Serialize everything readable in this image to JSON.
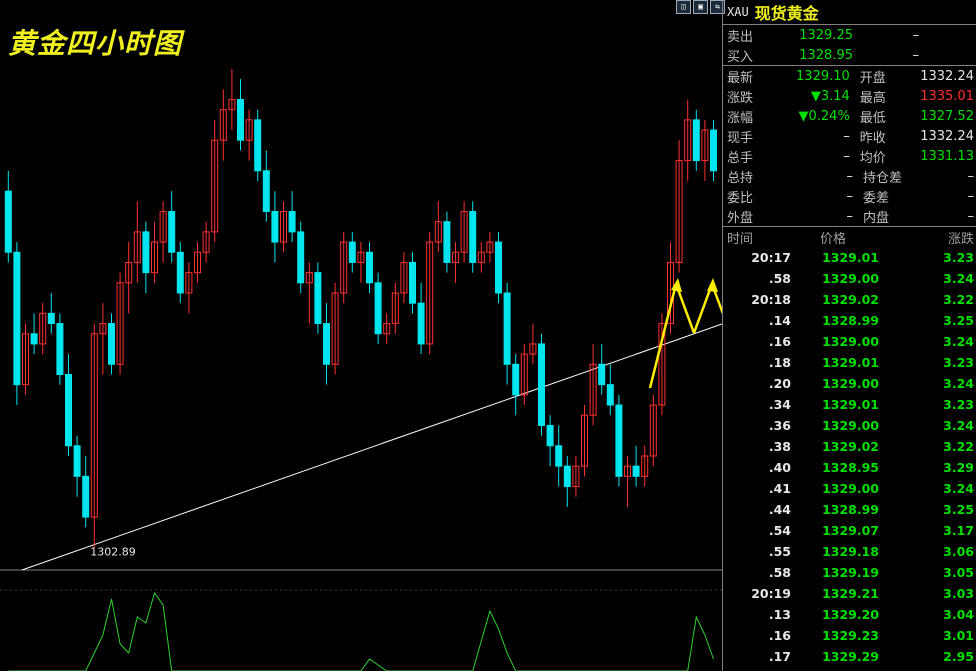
{
  "chart": {
    "title": "黄金四小时图",
    "low_label": "1302.89",
    "view_buttons": [
      "◫",
      "▣",
      "⇆"
    ]
  },
  "panel": {
    "code": "XAU",
    "name": "现货黄金",
    "ask_label": "卖出",
    "ask": "1329.25",
    "ask_vol": "–",
    "bid_label": "买入",
    "bid": "1328.95",
    "bid_vol": "–",
    "stats": [
      {
        "l1": "最新",
        "v1": "1329.10",
        "c1": "green",
        "l2": "开盘",
        "v2": "1332.24",
        "c2": "white"
      },
      {
        "l1": "涨跌",
        "v1": "▼3.14",
        "c1": "green",
        "l2": "最高",
        "v2": "1335.01",
        "c2": "red"
      },
      {
        "l1": "涨幅",
        "v1": "▼0.24%",
        "c1": "green",
        "l2": "最低",
        "v2": "1327.52",
        "c2": "green"
      },
      {
        "l1": "现手",
        "v1": "–",
        "c1": "white",
        "l2": "昨收",
        "v2": "1332.24",
        "c2": "white"
      },
      {
        "l1": "总手",
        "v1": "–",
        "c1": "white",
        "l2": "均价",
        "v2": "1331.13",
        "c2": "green"
      },
      {
        "l1": "总持",
        "v1": "–",
        "c1": "white",
        "l2": "持仓差",
        "v2": "–",
        "c2": "white"
      },
      {
        "l1": "委比",
        "v1": "–",
        "c1": "white",
        "l2": "委差",
        "v2": "–",
        "c2": "white"
      },
      {
        "l1": "外盘",
        "v1": "–",
        "c1": "white",
        "l2": "内盘",
        "v2": "–",
        "c2": "white"
      }
    ],
    "ticks_header": {
      "time": "时间",
      "price": "价格",
      "change": "涨跌"
    },
    "ticks": [
      {
        "t": "20:17",
        "p": "1329.01",
        "c": "3.23"
      },
      {
        "t": ".58",
        "p": "1329.00",
        "c": "3.24"
      },
      {
        "t": "20:18",
        "p": "1329.02",
        "c": "3.22"
      },
      {
        "t": ".14",
        "p": "1328.99",
        "c": "3.25"
      },
      {
        "t": ".16",
        "p": "1329.00",
        "c": "3.24"
      },
      {
        "t": ".18",
        "p": "1329.01",
        "c": "3.23"
      },
      {
        "t": ".20",
        "p": "1329.00",
        "c": "3.24"
      },
      {
        "t": ".34",
        "p": "1329.01",
        "c": "3.23"
      },
      {
        "t": ".36",
        "p": "1329.00",
        "c": "3.24"
      },
      {
        "t": ".38",
        "p": "1329.02",
        "c": "3.22"
      },
      {
        "t": ".40",
        "p": "1328.95",
        "c": "3.29"
      },
      {
        "t": ".41",
        "p": "1329.00",
        "c": "3.24"
      },
      {
        "t": ".44",
        "p": "1328.99",
        "c": "3.25"
      },
      {
        "t": ".54",
        "p": "1329.07",
        "c": "3.17"
      },
      {
        "t": ".55",
        "p": "1329.18",
        "c": "3.06"
      },
      {
        "t": ".58",
        "p": "1329.19",
        "c": "3.05"
      },
      {
        "t": "20:19",
        "p": "1329.21",
        "c": "3.03"
      },
      {
        "t": ".13",
        "p": "1329.20",
        "c": "3.04"
      },
      {
        "t": ".16",
        "p": "1329.23",
        "c": "3.01"
      },
      {
        "t": ".17",
        "p": "1329.29",
        "c": "2.95"
      }
    ]
  },
  "chart_data": {
    "type": "candlestick",
    "y_low_marker": 1302.89,
    "candles": [
      {
        "o": 1325,
        "h": 1327,
        "l": 1318,
        "c": 1319
      },
      {
        "o": 1319,
        "h": 1320,
        "l": 1304,
        "c": 1306
      },
      {
        "o": 1306,
        "h": 1312,
        "l": 1305,
        "c": 1311
      },
      {
        "o": 1311,
        "h": 1313,
        "l": 1309,
        "c": 1310
      },
      {
        "o": 1310,
        "h": 1314,
        "l": 1309,
        "c": 1313
      },
      {
        "o": 1313,
        "h": 1315,
        "l": 1311,
        "c": 1312
      },
      {
        "o": 1312,
        "h": 1313,
        "l": 1306,
        "c": 1307
      },
      {
        "o": 1307,
        "h": 1309,
        "l": 1299,
        "c": 1300
      },
      {
        "o": 1300,
        "h": 1301,
        "l": 1295,
        "c": 1297
      },
      {
        "o": 1297,
        "h": 1299,
        "l": 1292,
        "c": 1293
      },
      {
        "o": 1293,
        "h": 1312,
        "l": 1290,
        "c": 1311
      },
      {
        "o": 1311,
        "h": 1314,
        "l": 1307,
        "c": 1312
      },
      {
        "o": 1312,
        "h": 1313,
        "l": 1307,
        "c": 1308
      },
      {
        "o": 1308,
        "h": 1317,
        "l": 1307,
        "c": 1316
      },
      {
        "o": 1316,
        "h": 1320,
        "l": 1313,
        "c": 1318
      },
      {
        "o": 1318,
        "h": 1324,
        "l": 1316,
        "c": 1321
      },
      {
        "o": 1321,
        "h": 1322,
        "l": 1315,
        "c": 1317
      },
      {
        "o": 1317,
        "h": 1322,
        "l": 1316,
        "c": 1320
      },
      {
        "o": 1320,
        "h": 1324,
        "l": 1318,
        "c": 1323
      },
      {
        "o": 1323,
        "h": 1325,
        "l": 1318,
        "c": 1319
      },
      {
        "o": 1319,
        "h": 1320,
        "l": 1314,
        "c": 1315
      },
      {
        "o": 1315,
        "h": 1318,
        "l": 1313,
        "c": 1317
      },
      {
        "o": 1317,
        "h": 1320,
        "l": 1316,
        "c": 1319
      },
      {
        "o": 1319,
        "h": 1322,
        "l": 1318,
        "c": 1321
      },
      {
        "o": 1321,
        "h": 1332,
        "l": 1320,
        "c": 1330
      },
      {
        "o": 1330,
        "h": 1335,
        "l": 1328,
        "c": 1333
      },
      {
        "o": 1333,
        "h": 1337,
        "l": 1331,
        "c": 1334
      },
      {
        "o": 1334,
        "h": 1336,
        "l": 1329,
        "c": 1330
      },
      {
        "o": 1330,
        "h": 1333,
        "l": 1328,
        "c": 1332
      },
      {
        "o": 1332,
        "h": 1333,
        "l": 1326,
        "c": 1327
      },
      {
        "o": 1327,
        "h": 1329,
        "l": 1322,
        "c": 1323
      },
      {
        "o": 1323,
        "h": 1325,
        "l": 1318,
        "c": 1320
      },
      {
        "o": 1320,
        "h": 1324,
        "l": 1319,
        "c": 1323
      },
      {
        "o": 1323,
        "h": 1325,
        "l": 1320,
        "c": 1321
      },
      {
        "o": 1321,
        "h": 1322,
        "l": 1315,
        "c": 1316
      },
      {
        "o": 1316,
        "h": 1318,
        "l": 1312,
        "c": 1317
      },
      {
        "o": 1317,
        "h": 1318,
        "l": 1311,
        "c": 1312
      },
      {
        "o": 1312,
        "h": 1314,
        "l": 1306,
        "c": 1308
      },
      {
        "o": 1308,
        "h": 1316,
        "l": 1307,
        "c": 1315
      },
      {
        "o": 1315,
        "h": 1321,
        "l": 1314,
        "c": 1320
      },
      {
        "o": 1320,
        "h": 1321,
        "l": 1317,
        "c": 1318
      },
      {
        "o": 1318,
        "h": 1320,
        "l": 1316,
        "c": 1319
      },
      {
        "o": 1319,
        "h": 1320,
        "l": 1315,
        "c": 1316
      },
      {
        "o": 1316,
        "h": 1317,
        "l": 1310,
        "c": 1311
      },
      {
        "o": 1311,
        "h": 1313,
        "l": 1310,
        "c": 1312
      },
      {
        "o": 1312,
        "h": 1316,
        "l": 1311,
        "c": 1315
      },
      {
        "o": 1315,
        "h": 1319,
        "l": 1314,
        "c": 1318
      },
      {
        "o": 1318,
        "h": 1319,
        "l": 1313,
        "c": 1314
      },
      {
        "o": 1314,
        "h": 1316,
        "l": 1309,
        "c": 1310
      },
      {
        "o": 1310,
        "h": 1321,
        "l": 1309,
        "c": 1320
      },
      {
        "o": 1320,
        "h": 1324,
        "l": 1319,
        "c": 1322
      },
      {
        "o": 1322,
        "h": 1323,
        "l": 1317,
        "c": 1318
      },
      {
        "o": 1318,
        "h": 1320,
        "l": 1316,
        "c": 1319
      },
      {
        "o": 1319,
        "h": 1324,
        "l": 1318,
        "c": 1323
      },
      {
        "o": 1323,
        "h": 1324,
        "l": 1317,
        "c": 1318
      },
      {
        "o": 1318,
        "h": 1320,
        "l": 1317,
        "c": 1319
      },
      {
        "o": 1319,
        "h": 1321,
        "l": 1318,
        "c": 1320
      },
      {
        "o": 1320,
        "h": 1321,
        "l": 1314,
        "c": 1315
      },
      {
        "o": 1315,
        "h": 1316,
        "l": 1306,
        "c": 1308
      },
      {
        "o": 1308,
        "h": 1309,
        "l": 1303,
        "c": 1305
      },
      {
        "o": 1305,
        "h": 1310,
        "l": 1304,
        "c": 1309
      },
      {
        "o": 1309,
        "h": 1312,
        "l": 1308,
        "c": 1310
      },
      {
        "o": 1310,
        "h": 1311,
        "l": 1301,
        "c": 1302
      },
      {
        "o": 1302,
        "h": 1303,
        "l": 1298,
        "c": 1300
      },
      {
        "o": 1300,
        "h": 1302,
        "l": 1296,
        "c": 1298
      },
      {
        "o": 1298,
        "h": 1299,
        "l": 1294,
        "c": 1296
      },
      {
        "o": 1296,
        "h": 1299,
        "l": 1295,
        "c": 1298
      },
      {
        "o": 1298,
        "h": 1304,
        "l": 1297,
        "c": 1303
      },
      {
        "o": 1303,
        "h": 1310,
        "l": 1302,
        "c": 1308
      },
      {
        "o": 1308,
        "h": 1310,
        "l": 1305,
        "c": 1306
      },
      {
        "o": 1306,
        "h": 1308,
        "l": 1303,
        "c": 1304
      },
      {
        "o": 1304,
        "h": 1305,
        "l": 1296,
        "c": 1297
      },
      {
        "o": 1297,
        "h": 1299,
        "l": 1294,
        "c": 1298
      },
      {
        "o": 1298,
        "h": 1300,
        "l": 1296,
        "c": 1297
      },
      {
        "o": 1297,
        "h": 1300,
        "l": 1296,
        "c": 1299
      },
      {
        "o": 1299,
        "h": 1305,
        "l": 1298,
        "c": 1304
      },
      {
        "o": 1304,
        "h": 1313,
        "l": 1303,
        "c": 1312
      },
      {
        "o": 1312,
        "h": 1320,
        "l": 1311,
        "c": 1318
      },
      {
        "o": 1318,
        "h": 1330,
        "l": 1317,
        "c": 1328
      },
      {
        "o": 1328,
        "h": 1334,
        "l": 1326,
        "c": 1332
      },
      {
        "o": 1332,
        "h": 1333,
        "l": 1327,
        "c": 1328
      },
      {
        "o": 1328,
        "h": 1332,
        "l": 1326,
        "c": 1331
      },
      {
        "o": 1331,
        "h": 1332,
        "l": 1326,
        "c": 1327
      }
    ],
    "volume": [
      0,
      0,
      0,
      0,
      0,
      0,
      0,
      0,
      0,
      0,
      6,
      12,
      24,
      9,
      6,
      18,
      16,
      26,
      22,
      0,
      0,
      0,
      0,
      0,
      0,
      0,
      0,
      0,
      0,
      0,
      0,
      0,
      0,
      0,
      0,
      0,
      0,
      0,
      0,
      0,
      0,
      0,
      4,
      2,
      0,
      0,
      0,
      0,
      0,
      0,
      0,
      0,
      0,
      0,
      0,
      10,
      20,
      14,
      6,
      0,
      0,
      0,
      0,
      0,
      0,
      0,
      0,
      0,
      0,
      0,
      0,
      0,
      0,
      0,
      0,
      0,
      0,
      0,
      0,
      0,
      18,
      12,
      4
    ]
  }
}
